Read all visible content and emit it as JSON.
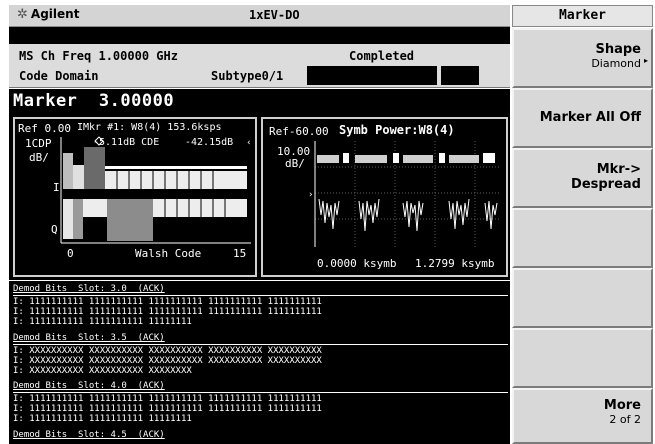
{
  "header": {
    "brand": "Agilent",
    "mode": "1xEV-DO"
  },
  "info": {
    "line1_left": "MS   Ch Freq 1.00000 GHz",
    "line1_status": "Completed",
    "line2_left": "Code Domain",
    "line2_mid": "Subtype0/1"
  },
  "marker_line": {
    "label": "Marker",
    "value": "3.00000"
  },
  "left_plot": {
    "ref": "Ref 0.00",
    "marker_readout": "IMkr #1: W8(4) 153.6ksps",
    "legend": "1CDP",
    "marker_cdp": "-5.11dB CDE",
    "cde_value": "-42.15dB",
    "unit": "dB/",
    "i_label": "I",
    "q_label": "Q",
    "axis_start": "0",
    "axis_title": "Walsh Code",
    "axis_end": "15"
  },
  "right_plot": {
    "ref": "Ref-60.00",
    "title": "Symb Power:W8(4)",
    "scale": "10.00",
    "unit": "dB/",
    "x_start": "0.0000 ksymb",
    "x_end": "1.2799 ksymb"
  },
  "demod_bits": [
    {
      "header": "Demod Bits  Slot: 3.0  (ACK)",
      "rows": [
        "I: 1111111111 1111111111 1111111111 1111111111 1111111111",
        "I: 1111111111 1111111111 1111111111 1111111111 1111111111",
        "I: 1111111111 1111111111 11111111"
      ]
    },
    {
      "header": "Demod Bits  Slot: 3.5  (ACK)",
      "rows": [
        "I: XXXXXXXXXX XXXXXXXXXX XXXXXXXXXX XXXXXXXXXX XXXXXXXXXX",
        "I: XXXXXXXXXX XXXXXXXXXX XXXXXXXXXX XXXXXXXXXX XXXXXXXXXX",
        "I: XXXXXXXXXX XXXXXXXXXX XXXXXXXX"
      ]
    },
    {
      "header": "Demod Bits  Slot: 4.0  (ACK)",
      "rows": [
        "I: 1111111111 1111111111 1111111111 1111111111 1111111111",
        "I: 1111111111 1111111111 1111111111 1111111111 1111111111",
        "I: 1111111111 1111111111 11111111"
      ]
    },
    {
      "header": "Demod Bits  Slot: 4.5  (ACK)",
      "rows": []
    }
  ],
  "softkeys": {
    "menu_title": "Marker",
    "shape_label": "Shape",
    "shape_value": "Diamond",
    "marker_all_off": "Marker All Off",
    "mkr_line1": "Mkr->",
    "mkr_line2": "Despread",
    "more_label": "More",
    "more_page": "2 of 2"
  }
}
